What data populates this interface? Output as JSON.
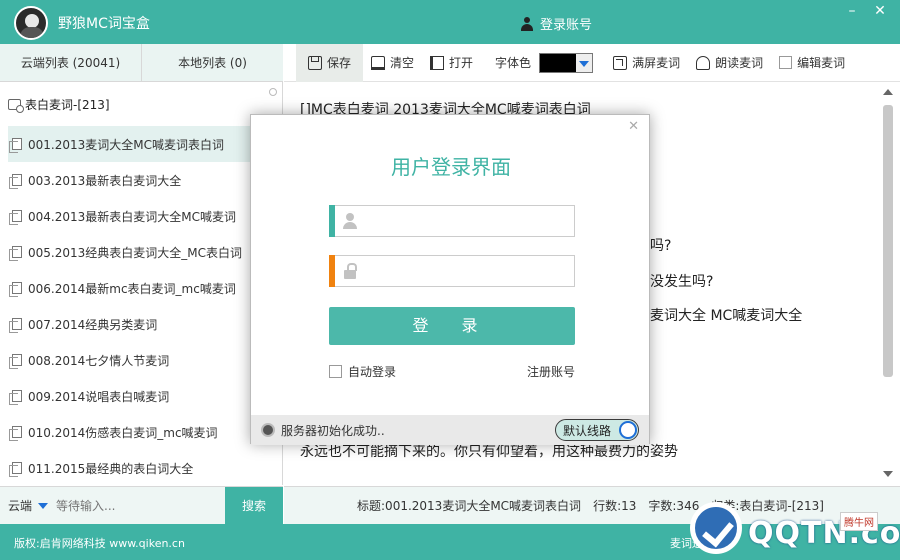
{
  "app": {
    "title": "野狼MC词宝盒",
    "login_label": "登录账号"
  },
  "window_controls": {
    "minimize": "–",
    "close": "✕"
  },
  "left_tabs": [
    "云端列表 (20041)",
    "本地列表 (0)"
  ],
  "tree": {
    "root": "表白麦词-[213]",
    "items": [
      "001.2013麦词大全MC喊麦词表白词",
      "003.2013最新表白麦词大全",
      "004.2013最新表白麦词大全MC喊麦词",
      "005.2013经典表白麦词大全_MC表白词",
      "006.2014最新mc表白麦词_mc喊麦词",
      "007.2014经典另类麦词",
      "008.2014七夕情人节麦词",
      "009.2014说唱表白喊麦词",
      "010.2014伤感表白麦词_mc喊麦词",
      "011.2015最经典的表白词大全"
    ]
  },
  "toolbar": {
    "save": "保存",
    "clear": "清空",
    "open": "打开",
    "font_color_label": "字体色",
    "font_color": "#000000",
    "fullscreen": "满屏麦词",
    "read": "朗读麦词",
    "edit": "编辑麦词"
  },
  "editor": {
    "lines": [
      "[]MC表白麦词 2013麦词大全MC喊麦词表白词",
      "吗?",
      "没发生吗?",
      "麦词大全 MC喊麦词大全",
      "永远也不可能摘下来的。你只有仰望着，用这种最费力的姿势"
    ]
  },
  "search": {
    "scope": "云端",
    "placeholder": "等待输入...",
    "button": "搜索"
  },
  "info": {
    "title": "标题:001.2013麦词大全MC喊麦词表白词",
    "lines": "行数:13",
    "chars": "字数:346",
    "category": "归类:表白麦词-[213]"
  },
  "footer": {
    "copyright": "版权:启肯网络科技 www.qiken.cn",
    "right_text": "麦词送话"
  },
  "watermark": {
    "text": "QQTN.com",
    "badge": "腾牛网"
  },
  "dialog": {
    "title": "用户登录界面",
    "username_bar_color": "#3fb3a4",
    "password_bar_color": "#f0820f",
    "login_button": "登 录",
    "auto_login": "自动登录",
    "register": "注册账号",
    "status": "服务器初始化成功..",
    "line_toggle": "默认线路",
    "close": "✕"
  },
  "colors": {
    "accent": "#3fb3a4",
    "highlight": "#e3f1ef"
  }
}
